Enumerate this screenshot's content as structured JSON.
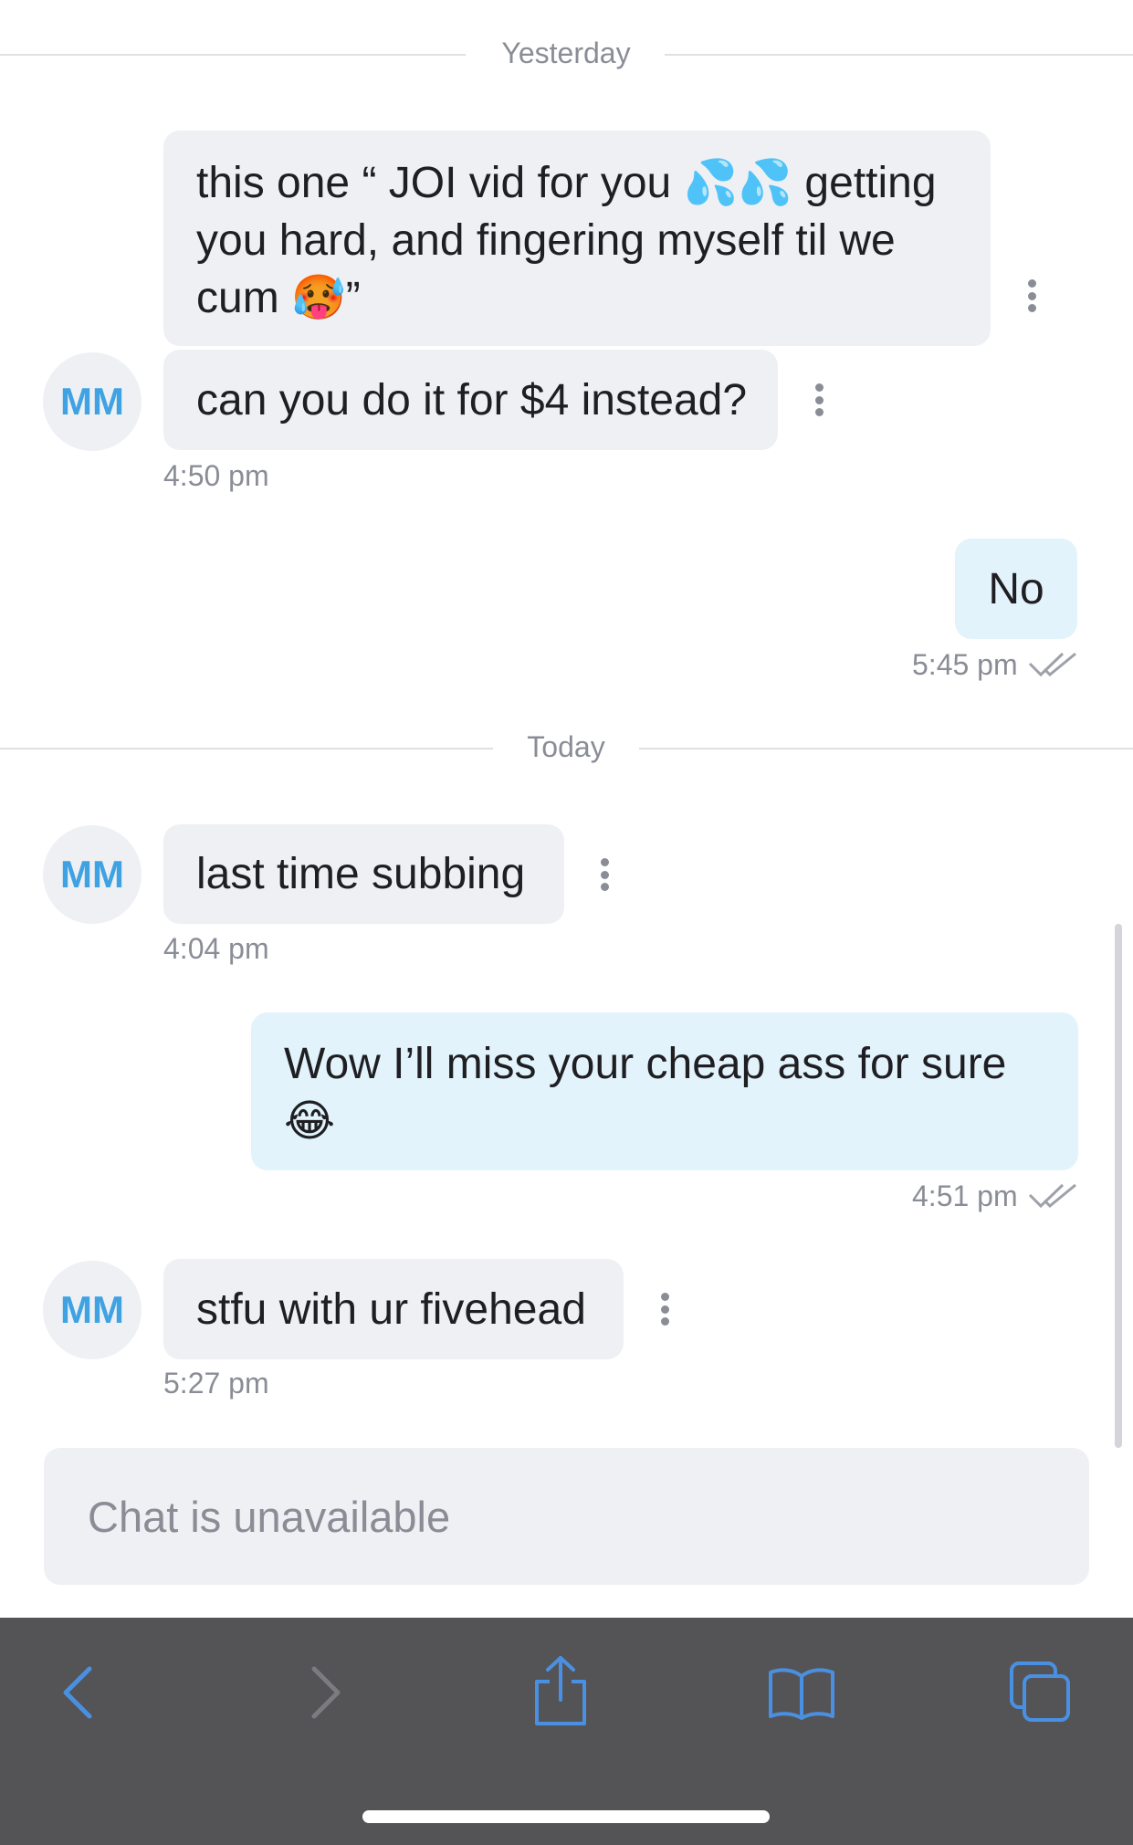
{
  "separators": {
    "yesterday": "Yesterday",
    "today": "Today"
  },
  "avatar_initials": "MM",
  "messages": [
    {
      "direction": "incoming",
      "lines": [
        "this one “ JOI vid for you 💦💦 getting",
        "you hard, and fingering myself til we",
        "cum 🥵”"
      ]
    },
    {
      "direction": "incoming",
      "text": "can you do it for $4 instead?",
      "time": "4:50 pm"
    },
    {
      "direction": "outgoing",
      "text": "No",
      "time": "5:45 pm"
    },
    {
      "direction": "incoming",
      "text": "last time subbing",
      "time": "4:04 pm"
    },
    {
      "direction": "outgoing",
      "lines": [
        "Wow I’ll miss your cheap ass for sure",
        "😂"
      ],
      "time": "4:51 pm"
    },
    {
      "direction": "incoming",
      "text": "stfu with ur fivehead",
      "time": "5:27 pm"
    }
  ],
  "composer": {
    "status": "Chat is unavailable"
  },
  "toolbar": {
    "icons": [
      "back-icon",
      "forward-icon",
      "share-icon",
      "bookmarks-icon",
      "tabs-icon"
    ]
  },
  "colors": {
    "incoming_bubble": "#eef0f4",
    "outgoing_bubble": "#e2f3fc",
    "accent": "#3fa3e3",
    "toolbar_bg": "#545456",
    "toolbar_icon": "#4a90e2"
  }
}
